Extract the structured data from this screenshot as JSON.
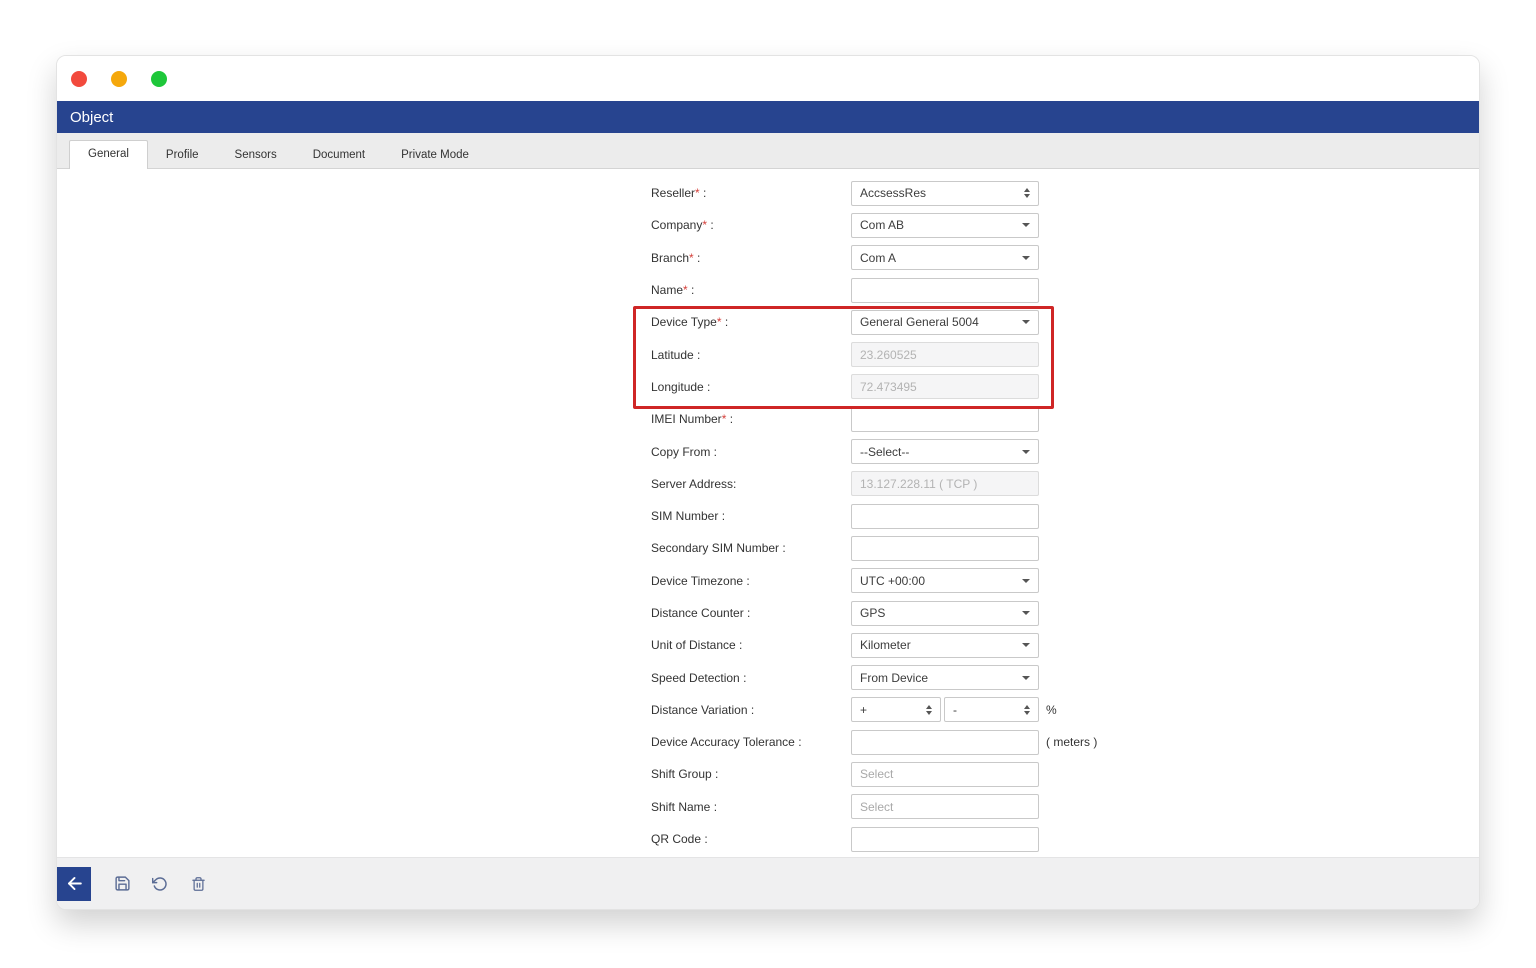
{
  "window": {
    "title": "Object"
  },
  "traffic_lights": {
    "close": "#f24a3d",
    "minimize": "#f5a80c",
    "zoom": "#1ec73a"
  },
  "tabs": [
    {
      "label": "General",
      "active": true
    },
    {
      "label": "Profile",
      "active": false
    },
    {
      "label": "Sensors",
      "active": false
    },
    {
      "label": "Document",
      "active": false
    },
    {
      "label": "Private Mode",
      "active": false
    }
  ],
  "form": {
    "required_marker": "*",
    "fields": [
      {
        "label": "Reseller",
        "colon": " :",
        "required": true,
        "control": "select",
        "caret": "updown",
        "value": "AccsessRes"
      },
      {
        "label": "Company",
        "colon": " :",
        "required": true,
        "control": "select",
        "caret": "down",
        "value": "Com AB"
      },
      {
        "label": "Branch",
        "colon": " :",
        "required": true,
        "control": "select",
        "caret": "down",
        "value": "Com A"
      },
      {
        "label": "Name",
        "colon": " :",
        "required": true,
        "control": "input",
        "value": ""
      },
      {
        "label": "Device Type",
        "colon": " :",
        "required": true,
        "control": "select",
        "caret": "down",
        "value": "General General 5004",
        "highlighted": true
      },
      {
        "label": "Latitude",
        "colon": " :",
        "control": "input",
        "value": "23.260525",
        "disabled": true,
        "highlighted": true
      },
      {
        "label": "Longitude",
        "colon": " :",
        "control": "input",
        "value": "72.473495",
        "disabled": true,
        "highlighted": true
      },
      {
        "label": "IMEI Number",
        "colon": " :",
        "required": true,
        "control": "input",
        "value": ""
      },
      {
        "label": "Copy From",
        "colon": " :",
        "control": "select",
        "caret": "down",
        "value": "--Select--"
      },
      {
        "label": "Server Address",
        "colon": ":",
        "control": "input",
        "value": "13.127.228.11 ( TCP )",
        "disabled": true
      },
      {
        "label": "SIM Number",
        "colon": " :",
        "control": "input",
        "value": ""
      },
      {
        "label": "Secondary SIM Number",
        "colon": " :",
        "control": "input",
        "value": ""
      },
      {
        "label": "Device Timezone",
        "colon": " :",
        "control": "select",
        "caret": "down",
        "value": "UTC +00:00"
      },
      {
        "label": "Distance Counter",
        "colon": " :",
        "control": "select",
        "caret": "down",
        "value": "GPS"
      },
      {
        "label": "Unit of Distance",
        "colon": " :",
        "control": "select",
        "caret": "down",
        "value": "Kilometer"
      },
      {
        "label": "Speed Detection",
        "colon": " :",
        "control": "select",
        "caret": "down",
        "value": "From Device"
      },
      {
        "label": "Distance Variation",
        "colon": " :",
        "control": "dual",
        "values": [
          "+",
          "-"
        ],
        "suffix": "%"
      },
      {
        "label": "Device Accuracy Tolerance",
        "colon": " :",
        "control": "input",
        "value": "",
        "suffix": "( meters )"
      },
      {
        "label": "Shift Group",
        "colon": " :",
        "control": "input",
        "placeholder": "Select"
      },
      {
        "label": "Shift Name",
        "colon": " :",
        "control": "input",
        "placeholder": "Select"
      },
      {
        "label": "QR Code",
        "colon": " :",
        "control": "input",
        "value": ""
      }
    ]
  },
  "annotation": {
    "highlight_color": "#cf2626",
    "highlighted_fields": [
      "Device Type",
      "Latitude",
      "Longitude"
    ]
  },
  "toolbar": {
    "icons": [
      "back-arrow",
      "save",
      "refresh",
      "trash"
    ]
  },
  "colors": {
    "titlebar": "#27448f",
    "back_button": "#27448f",
    "toolbar_icon": "#5b6c95"
  }
}
